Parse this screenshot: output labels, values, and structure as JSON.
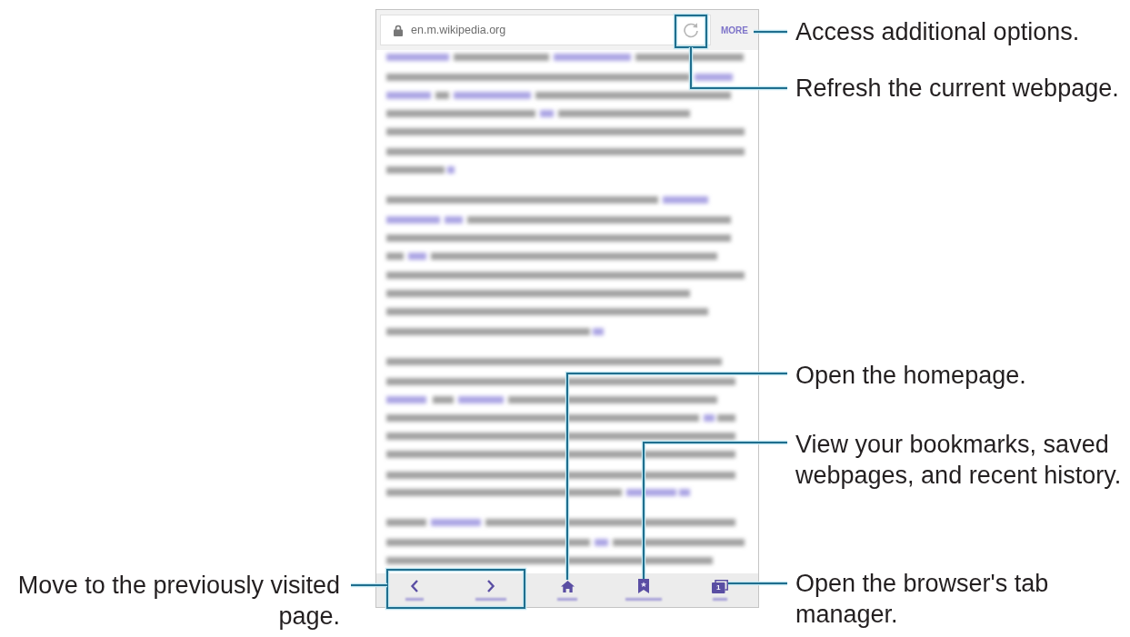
{
  "browser": {
    "address_bar": {
      "url": "en.m.wikipedia.org",
      "more_label": "MORE"
    },
    "toolbar": [
      {
        "kind": "back"
      },
      {
        "kind": "forward"
      },
      {
        "kind": "home"
      },
      {
        "kind": "bookmarks"
      },
      {
        "kind": "tabs",
        "count": "1"
      }
    ]
  },
  "callouts": [
    {
      "text": "Access additional options.",
      "kind": "more"
    },
    {
      "text": "Refresh the current webpage.",
      "kind": "refresh"
    },
    {
      "text": "Open the homepage.",
      "kind": "home"
    },
    {
      "text": "View your bookmarks, saved webpages, and recent history.",
      "kind": "bookmarks"
    },
    {
      "text": "Move to the previously visited page.",
      "kind": "back_forward"
    },
    {
      "text": "Open the browser's tab manager.",
      "kind": "tabs"
    }
  ]
}
